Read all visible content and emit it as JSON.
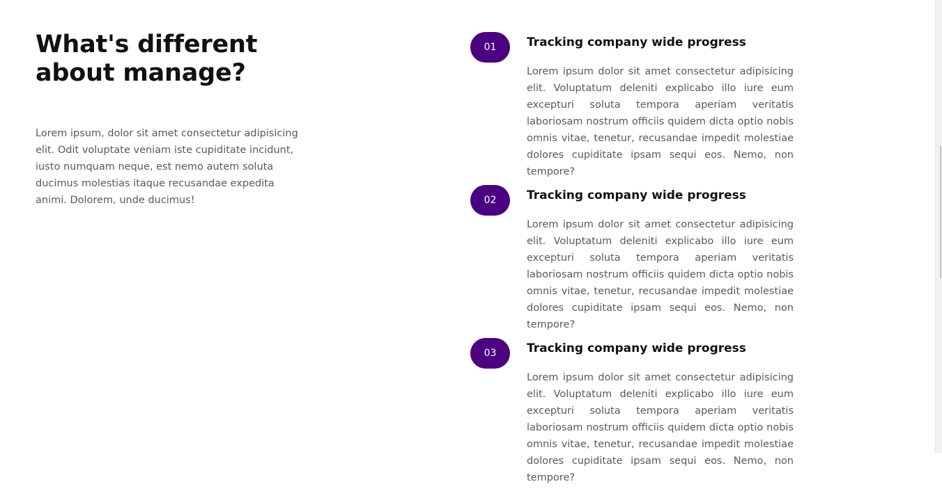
{
  "intro": {
    "heading": "What's different about manage?",
    "body": "Lorem ipsum, dolor sit amet consectetur adipisicing elit. Odit voluptate veniam iste cupiditate incidunt, iusto numquam neque, est nemo autem soluta ducimus molestias itaque recusandae expedita animi. Dolorem, unde ducimus!"
  },
  "features": [
    {
      "number": "01",
      "title": "Tracking company wide progress",
      "body": "Lorem ipsum dolor sit amet consectetur adipisicing elit. Voluptatum deleniti explicabo illo iure eum excepturi soluta tempora aperiam veritatis laboriosam nostrum officiis quidem dicta optio nobis omnis vitae, tenetur, recusandae impedit molestiae dolores cupiditate ipsam sequi eos. Nemo, non tempore?"
    },
    {
      "number": "02",
      "title": "Tracking company wide progress",
      "body": "Lorem ipsum dolor sit amet consectetur adipisicing elit. Voluptatum deleniti explicabo illo iure eum excepturi soluta tempora aperiam veritatis laboriosam nostrum officiis quidem dicta optio nobis omnis vitae, tenetur, recusandae impedit molestiae dolores cupiditate ipsam sequi eos. Nemo, non tempore?"
    },
    {
      "number": "03",
      "title": "Tracking company wide progress",
      "body": "Lorem ipsum dolor sit amet consectetur adipisicing elit. Voluptatum deleniti explicabo illo iure eum excepturi soluta tempora aperiam veritatis laboriosam nostrum officiis quidem dicta optio nobis omnis vitae, tenetur, recusandae impedit molestiae dolores cupiditate ipsam sequi eos. Nemo, non tempore?"
    }
  ],
  "colors": {
    "accent": "#4b0082",
    "heading": "#111111",
    "body_text": "#555a60"
  }
}
